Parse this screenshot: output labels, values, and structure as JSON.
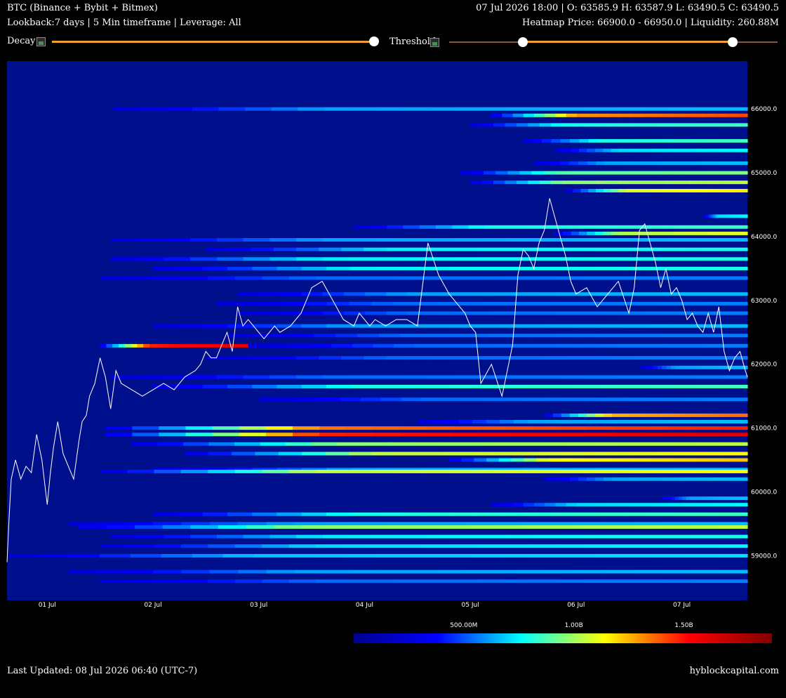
{
  "header": {
    "title": "BTC (Binance + Bybit + Bitmex)",
    "subtitle": "Lookback:7 days | 5 Min timeframe | Leverage: All",
    "ohlc": "07 Jul 2026 18:00 | O: 63585.9 H: 63587.9 L: 63490.5 C: 63490.5",
    "heatmap_info": "Heatmap Price: 66900.0 - 66950.0 | Liquidity: 260.88M"
  },
  "controls": {
    "decay_label": "Decay",
    "threshold_label": "Threshold",
    "decay_value": 1.0,
    "threshold_range": [
      0.22,
      0.86
    ],
    "accent_color": "#f0a030"
  },
  "footer": {
    "last_updated": "Last Updated: 08 Jul 2026 06:40 (UTC-7)",
    "site": "hyblockcapital.com"
  },
  "colorbar": {
    "ticks": [
      "500.00M",
      "1.00B",
      "1.50B"
    ],
    "tick_values": [
      500,
      1000,
      1500
    ],
    "min": 0,
    "max": 1900,
    "colors": [
      "#00008f",
      "#0000ff",
      "#00ffff",
      "#ffff00",
      "#ff0000",
      "#800000"
    ]
  },
  "chart_data": {
    "type": "heatmap",
    "title": "",
    "xlabel": "",
    "ylabel": "",
    "ylim": [
      58300,
      66750
    ],
    "xlim": [
      0.62,
      7.62
    ],
    "x_ticks": [
      "01 Jul",
      "02 Jul",
      "03 Jul",
      "04 Jul",
      "05 Jul",
      "06 Jul",
      "07 Jul"
    ],
    "x_tick_values": [
      1,
      2,
      3,
      4,
      5,
      6,
      7
    ],
    "y_ticks": [
      "59000.0",
      "60000.0",
      "61000.0",
      "62000.0",
      "63000.0",
      "64000.0",
      "65000.0",
      "66000.0"
    ],
    "y_tick_values": [
      59000,
      60000,
      61000,
      62000,
      63000,
      64000,
      65000,
      66000
    ],
    "background_color": "#00108c",
    "price_series": {
      "color": "#ffffff",
      "x": [
        0.62,
        0.64,
        0.66,
        0.7,
        0.75,
        0.8,
        0.85,
        0.9,
        0.95,
        1.0,
        1.03,
        1.06,
        1.1,
        1.15,
        1.2,
        1.25,
        1.3,
        1.33,
        1.37,
        1.4,
        1.45,
        1.5,
        1.55,
        1.6,
        1.65,
        1.7,
        1.8,
        1.9,
        2.0,
        2.1,
        2.2,
        2.3,
        2.4,
        2.45,
        2.5,
        2.55,
        2.6,
        2.65,
        2.7,
        2.75,
        2.8,
        2.85,
        2.9,
        2.95,
        3.0,
        3.05,
        3.1,
        3.15,
        3.2,
        3.3,
        3.4,
        3.5,
        3.6,
        3.7,
        3.8,
        3.9,
        3.95,
        4.0,
        4.05,
        4.1,
        4.2,
        4.3,
        4.4,
        4.5,
        4.6,
        4.7,
        4.8,
        4.9,
        4.95,
        5.0,
        5.05,
        5.1,
        5.2,
        5.3,
        5.4,
        5.45,
        5.5,
        5.55,
        5.6,
        5.65,
        5.7,
        5.75,
        5.8,
        5.85,
        5.9,
        5.95,
        6.0,
        6.1,
        6.2,
        6.3,
        6.4,
        6.5,
        6.55,
        6.6,
        6.65,
        6.7,
        6.75,
        6.8,
        6.85,
        6.9,
        6.95,
        7.0,
        7.05,
        7.1,
        7.15,
        7.2,
        7.25,
        7.3,
        7.35,
        7.4,
        7.45,
        7.5,
        7.55,
        7.6,
        7.62
      ],
      "y": [
        58900,
        59600,
        60200,
        60500,
        60200,
        60400,
        60300,
        60900,
        60500,
        59800,
        60300,
        60700,
        61100,
        60600,
        60400,
        60200,
        60800,
        61100,
        61200,
        61500,
        61700,
        62100,
        61800,
        61300,
        61900,
        61700,
        61600,
        61500,
        61600,
        61700,
        61600,
        61800,
        61900,
        62000,
        62200,
        62100,
        62100,
        62300,
        62500,
        62200,
        62900,
        62600,
        62700,
        62600,
        62500,
        62400,
        62500,
        62600,
        62500,
        62600,
        62800,
        63200,
        63300,
        63000,
        62700,
        62600,
        62800,
        62700,
        62600,
        62700,
        62600,
        62700,
        62700,
        62600,
        63900,
        63400,
        63100,
        62900,
        62800,
        62600,
        62500,
        61700,
        62000,
        61500,
        62300,
        63400,
        63800,
        63700,
        63500,
        63900,
        64100,
        64600,
        64300,
        64000,
        63700,
        63300,
        63100,
        63200,
        62900,
        63100,
        63300,
        62800,
        63200,
        64100,
        64200,
        63900,
        63600,
        63200,
        63500,
        63100,
        63200,
        63000,
        62700,
        62800,
        62600,
        62500,
        62800,
        62500,
        62900,
        62200,
        61900,
        62100,
        62200,
        61900,
        61800
      ]
    },
    "bands": [
      {
        "price": 66000,
        "start": 1.62,
        "intensity": 0.35
      },
      {
        "price": 65900,
        "start": 5.2,
        "intensity": 0.75
      },
      {
        "price": 65750,
        "start": 5.0,
        "intensity": 0.45
      },
      {
        "price": 65500,
        "start": 5.5,
        "intensity": 0.45
      },
      {
        "price": 65350,
        "start": 5.8,
        "intensity": 0.4
      },
      {
        "price": 65150,
        "start": 5.6,
        "intensity": 0.35
      },
      {
        "price": 65000,
        "start": 4.9,
        "intensity": 0.5
      },
      {
        "price": 64850,
        "start": 5.0,
        "intensity": 0.55
      },
      {
        "price": 64720,
        "start": 5.9,
        "intensity": 0.62
      },
      {
        "price": 64320,
        "start": 7.2,
        "intensity": 0.4
      },
      {
        "price": 64150,
        "start": 3.9,
        "intensity": 0.45
      },
      {
        "price": 64050,
        "start": 5.8,
        "intensity": 0.58
      },
      {
        "price": 63950,
        "start": 1.6,
        "intensity": 0.35
      },
      {
        "price": 63800,
        "start": 2.5,
        "intensity": 0.42
      },
      {
        "price": 63650,
        "start": 1.6,
        "intensity": 0.42
      },
      {
        "price": 63500,
        "start": 2.0,
        "intensity": 0.42
      },
      {
        "price": 63350,
        "start": 1.5,
        "intensity": 0.3
      },
      {
        "price": 63100,
        "start": 2.8,
        "intensity": 0.35
      },
      {
        "price": 62950,
        "start": 2.6,
        "intensity": 0.3
      },
      {
        "price": 62800,
        "start": 2.8,
        "intensity": 0.3
      },
      {
        "price": 62600,
        "start": 2.0,
        "intensity": 0.35
      },
      {
        "price": 62450,
        "start": 2.7,
        "intensity": 0.3
      },
      {
        "price": 62290,
        "start": 1.5,
        "intensity": 0.85,
        "end": 2.9
      },
      {
        "price": 62290,
        "start": 2.9,
        "intensity": 0.3
      },
      {
        "price": 62100,
        "start": 2.5,
        "intensity": 0.3
      },
      {
        "price": 61950,
        "start": 6.6,
        "intensity": 0.35
      },
      {
        "price": 61800,
        "start": 1.6,
        "intensity": 0.3
      },
      {
        "price": 61650,
        "start": 2.0,
        "intensity": 0.45
      },
      {
        "price": 61450,
        "start": 3.0,
        "intensity": 0.3
      },
      {
        "price": 61200,
        "start": 5.7,
        "intensity": 0.72
      },
      {
        "price": 61100,
        "start": 4.5,
        "intensity": 0.35
      },
      {
        "price": 61000,
        "start": 1.55,
        "intensity": 0.78
      },
      {
        "price": 60900,
        "start": 1.55,
        "intensity": 0.85
      },
      {
        "price": 60750,
        "start": 1.8,
        "intensity": 0.55
      },
      {
        "price": 60600,
        "start": 2.3,
        "intensity": 0.6
      },
      {
        "price": 60500,
        "start": 4.8,
        "intensity": 0.65
      },
      {
        "price": 60350,
        "start": 2.0,
        "intensity": 0.35
      },
      {
        "price": 60320,
        "start": 1.5,
        "intensity": 0.6
      },
      {
        "price": 60200,
        "start": 5.7,
        "intensity": 0.35
      },
      {
        "price": 59900,
        "start": 6.8,
        "intensity": 0.35
      },
      {
        "price": 59800,
        "start": 5.2,
        "intensity": 0.4
      },
      {
        "price": 59650,
        "start": 2.0,
        "intensity": 0.45
      },
      {
        "price": 59500,
        "start": 1.2,
        "intensity": 0.35
      },
      {
        "price": 59450,
        "start": 1.3,
        "intensity": 0.55
      },
      {
        "price": 59300,
        "start": 1.6,
        "intensity": 0.42
      },
      {
        "price": 59150,
        "start": 1.5,
        "intensity": 0.4
      },
      {
        "price": 59000,
        "start": 0.62,
        "intensity": 0.38
      },
      {
        "price": 58750,
        "start": 1.2,
        "intensity": 0.35
      },
      {
        "price": 58600,
        "start": 1.5,
        "intensity": 0.3
      }
    ]
  }
}
